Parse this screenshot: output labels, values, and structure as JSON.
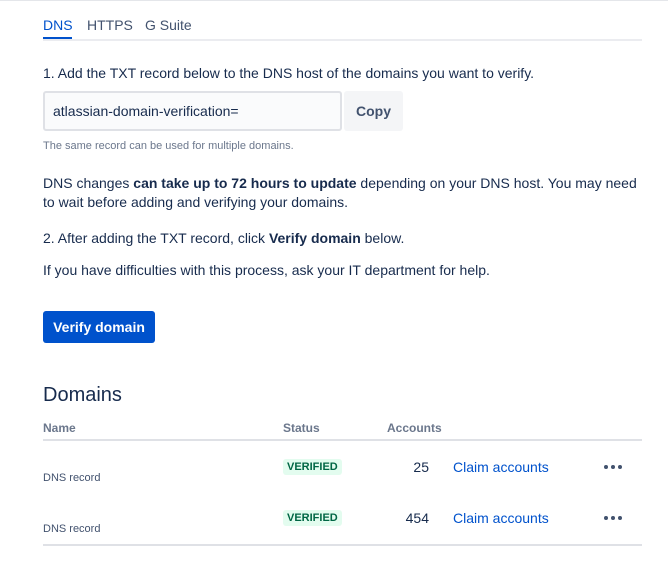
{
  "tabs": [
    {
      "label": "DNS",
      "active": true
    },
    {
      "label": "HTTPS",
      "active": false
    },
    {
      "label": "G Suite",
      "active": false
    }
  ],
  "step1": {
    "text": "1. Add the TXT record below to the DNS host of the domains you want to verify.",
    "record_value": "atlassian-domain-verification=",
    "copy_label": "Copy",
    "helper": "The same record can be used for multiple domains."
  },
  "dns_note": {
    "prefix": "DNS changes ",
    "bold": "can take up to 72 hours to update",
    "suffix": " depending on your DNS host. You may need",
    "line2": "to wait before adding and verifying your domains."
  },
  "step2": {
    "prefix": "2. After adding the TXT record, click ",
    "bold": "Verify domain",
    "suffix": " below."
  },
  "help_text": "If you have difficulties with this process, ask your IT department for help.",
  "verify_label": "Verify domain",
  "domains": {
    "title": "Domains",
    "columns": {
      "name": "Name",
      "status": "Status",
      "accounts": "Accounts"
    },
    "rows": [
      {
        "name": "DNS record",
        "status": "VERIFIED",
        "accounts": "25",
        "action": "Claim accounts",
        "more_icon": "more-horizontal-icon"
      },
      {
        "name": "DNS record",
        "status": "VERIFIED",
        "accounts": "454",
        "action": "Claim accounts",
        "more_icon": "more-horizontal-icon"
      }
    ]
  },
  "colors": {
    "primary": "#0052cc",
    "text": "#172b4d",
    "subtle": "#6b778c",
    "badge_bg": "#e3fcef",
    "badge_text": "#006644"
  }
}
